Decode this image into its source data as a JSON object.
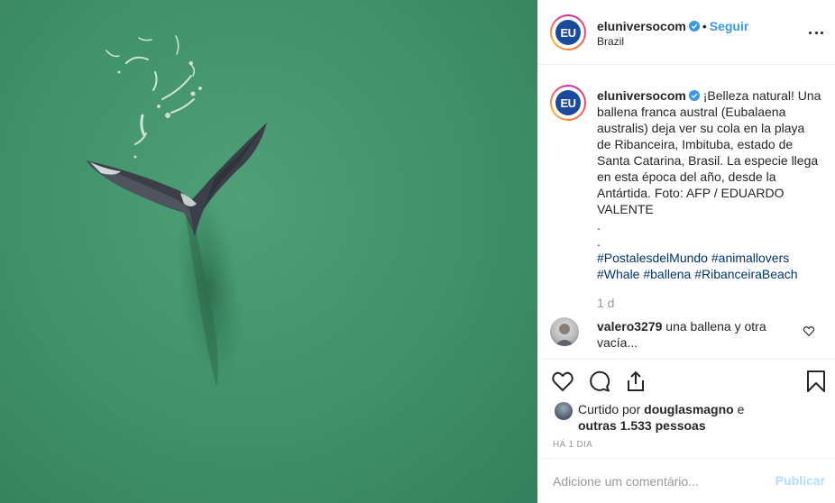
{
  "post": {
    "image_subject": "whale-tail-aerial"
  },
  "header": {
    "username": "eluniversocom",
    "separator": "•",
    "follow_label": "Seguir",
    "location": "Brazil",
    "avatar_text": "EU"
  },
  "caption": {
    "username": "eluniversocom",
    "lines": [
      "¡Belleza natural! Una",
      "ballena franca austral (Eubalaena",
      "australis) deja ver su cola en la playa",
      "de Ribanceira, Imbituba, estado de",
      "Santa Catarina, Brasil. La especie llega",
      "en esta época del año, desde la",
      "Antártida. Foto: AFP / EDUARDO",
      "VALENTE",
      ".",
      "."
    ],
    "hashtags_line1": [
      "#PostalesdelMundo",
      "#animallovers"
    ],
    "hashtags_line2": [
      "#Whale",
      "#ballena",
      "#RibanceiraBeach"
    ],
    "time_ago": "1 d"
  },
  "reply": {
    "username": "valero3279",
    "text": "una ballena y otra vacía..."
  },
  "likes": {
    "prefix": "Curtido por",
    "user": "douglasmagno",
    "conj": "e",
    "others": "outras 1.533 pessoas"
  },
  "timestamp": "HÁ 1 DIA",
  "comment_box": {
    "placeholder": "Adicione um comentário...",
    "submit_label": "Publicar"
  },
  "colors": {
    "water": "#3f9169",
    "link": "#3897f0",
    "hashtag": "#003569",
    "avatar_logo": "#1a4a9b"
  },
  "icons": [
    "verified-icon",
    "more-options-icon",
    "heart-icon",
    "comment-icon",
    "share-icon",
    "bookmark-icon"
  ]
}
